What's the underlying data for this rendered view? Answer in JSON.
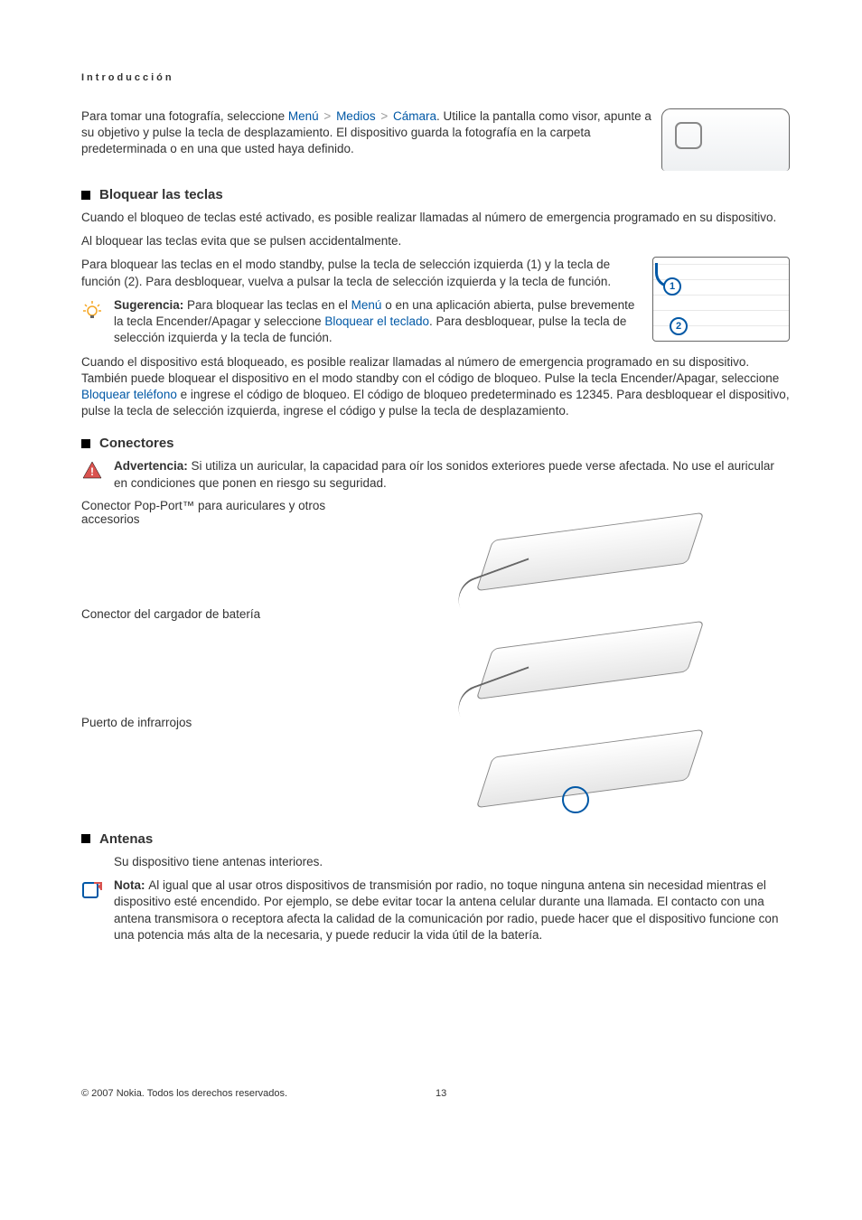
{
  "header": "Introducción",
  "intro": {
    "p1a": "Para tomar una fotografía, seleccione ",
    "menu": "Menú",
    "medios": "Medios",
    "camara": "Cámara",
    "p1b": ". Utilice la pantalla como visor, apunte a su objetivo y pulse la tecla de desplazamiento. El dispositivo guarda la fotografía en la carpeta predeterminada o en una que usted haya definido."
  },
  "lock": {
    "title": "Bloquear las teclas",
    "p1": "Cuando el bloqueo de teclas esté activado, es posible realizar llamadas al número de emergencia programado en su dispositivo.",
    "p2": "Al bloquear las teclas evita que se pulsen accidentalmente.",
    "p3": "Para bloquear las teclas en el modo standby, pulse la tecla de selección izquierda (1) y la tecla de función (2). Para desbloquear, vuelva a pulsar la tecla de selección izquierda y la tecla de función.",
    "tip_label": "Sugerencia: ",
    "tip_a": "Para bloquear las teclas en el ",
    "tip_menu": "Menú",
    "tip_b": " o en una aplicación abierta, pulse brevemente la tecla Encender/Apagar y seleccione ",
    "tip_link": "Bloquear el teclado",
    "tip_c": ". Para desbloquear, pulse la tecla de selección izquierda y la tecla de función.",
    "p4a": "Cuando el dispositivo está bloqueado, es posible realizar llamadas al número de emergencia programado en su dispositivo. También puede bloquear el dispositivo en el modo standby con el código de bloqueo. Pulse la tecla Encender/Apagar, seleccione ",
    "p4_link": "Bloquear teléfono",
    "p4b": " e ingrese el código de bloqueo. El código de bloqueo predeterminado es 12345. Para desbloquear el dispositivo, pulse la tecla de selección izquierda, ingrese el código y pulse la tecla de desplazamiento."
  },
  "connectors": {
    "title": "Conectores",
    "warn_label": "Advertencia:  ",
    "warn_body": "Si utiliza un auricular, la capacidad para oír los sonidos exteriores puede verse afectada. No use el auricular en condiciones que ponen en riesgo su seguridad.",
    "row1": "Conector Pop-Port™ para auriculares y otros accesorios",
    "row2": "Conector del cargador de batería",
    "row3": "Puerto de infrarrojos"
  },
  "antennas": {
    "title": "Antenas",
    "p1": "Su dispositivo tiene antenas interiores.",
    "note_label": "Nota:  ",
    "note_body": "Al igual que al usar otros dispositivos de transmisión por radio, no toque ninguna antena sin necesidad mientras el dispositivo esté encendido. Por ejemplo, se debe evitar tocar la antena celular durante una llamada. El contacto con una antena transmisora o receptora afecta la calidad de la comunicación por radio, puede hacer que el dispositivo funcione con una potencia más alta de la necesaria, y puede reducir la vida útil de la batería."
  },
  "footer": {
    "copy": "© 2007 Nokia. Todos los derechos reservados.",
    "page": "13"
  },
  "keypad_labels": {
    "one": "1",
    "two": "2"
  }
}
